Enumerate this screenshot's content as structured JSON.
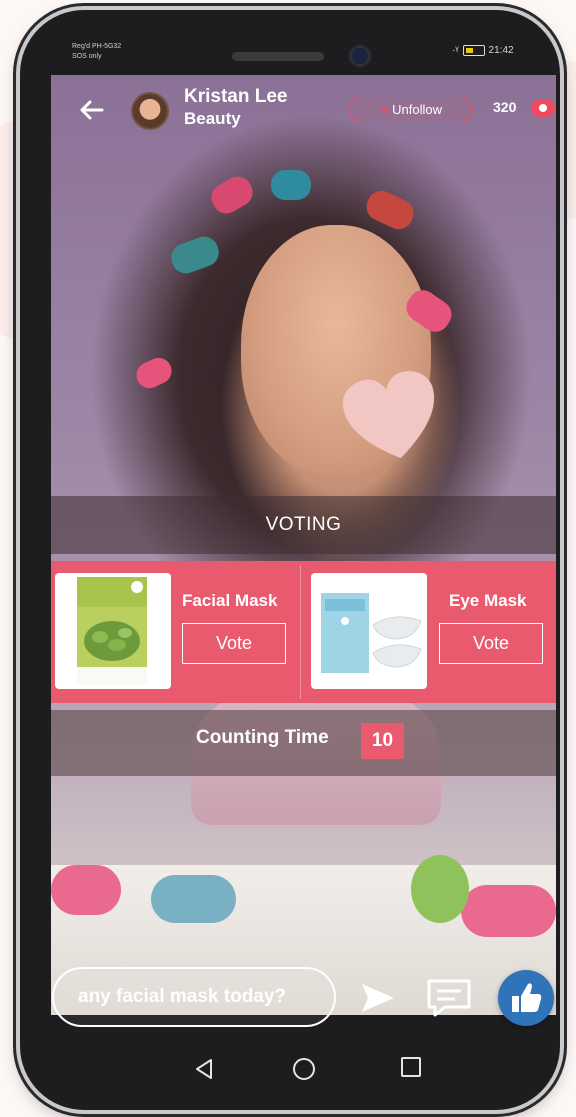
{
  "status_bar": {
    "carrier_line1": "Reg'd PH-5G32",
    "carrier_line2": "SOS only",
    "time": "21:42"
  },
  "header": {
    "back_icon": "arrow-left-icon",
    "streamer_name": "Kristan Lee",
    "streamer_category": "Beauty",
    "unfollow_label": "Unfollow",
    "viewer_count": "320",
    "viewer_icon": "eye-icon"
  },
  "voting": {
    "title": "VOTING",
    "options": [
      {
        "name": "Facial Mask",
        "vote_label": "Vote"
      },
      {
        "name": "Eye Mask",
        "vote_label": "Vote"
      }
    ],
    "counting_label": "Counting Time",
    "counting_value": "10"
  },
  "comment_bar": {
    "input_value": "any facial mask today?",
    "send_icon": "send-icon",
    "chat_icon": "chat-icon",
    "like_icon": "thumbs-up-icon"
  },
  "navigation": {
    "back_icon": "nav-back-icon",
    "home_icon": "nav-home-icon",
    "recent_icon": "nav-recent-icon"
  },
  "colors": {
    "accent": "#ea5a6e",
    "like": "#2f73b8"
  }
}
